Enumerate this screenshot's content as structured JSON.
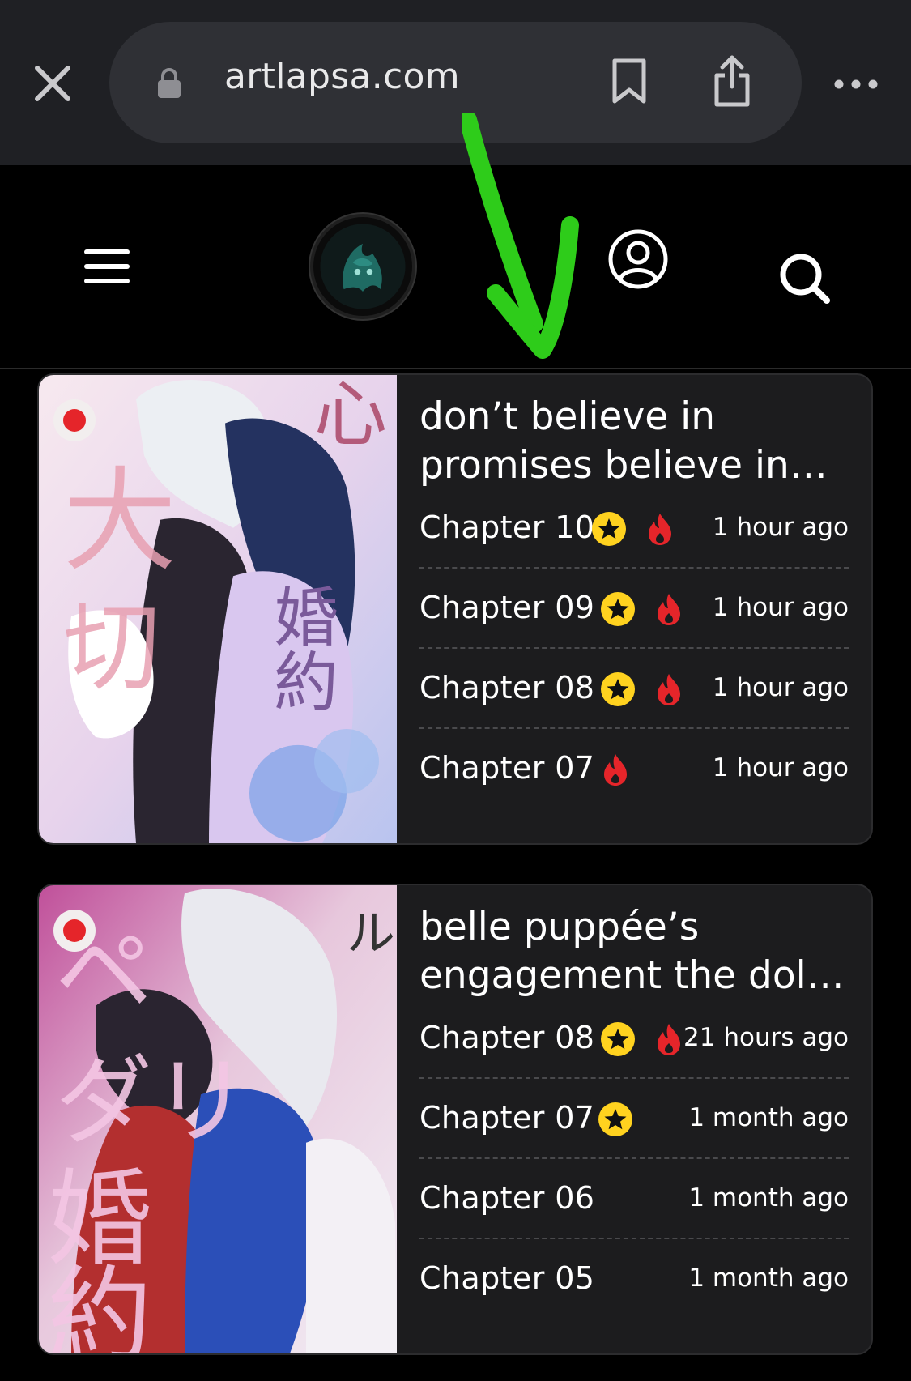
{
  "browser": {
    "url": "artlapsa.com",
    "icons": [
      "close-icon",
      "lock-icon",
      "bookmark-icon",
      "share-icon",
      "more-icon"
    ]
  },
  "header": {
    "icons": [
      "hamburger-icon",
      "site-logo",
      "user-icon",
      "search-icon"
    ]
  },
  "colors": {
    "background": "#000000",
    "card": "#1c1c1e",
    "star_badge": "#ffd21f",
    "fire_icon": "#e5252a",
    "annotation_arrow": "#2ecc1a"
  },
  "series": [
    {
      "title_line1": "don’t believe in",
      "title_line2": "promises believe in…",
      "chapters": [
        {
          "name": "Chapter 10",
          "time": "1 hour ago",
          "star": true,
          "fire": true
        },
        {
          "name": "Chapter 09",
          "time": "1 hour ago",
          "star": true,
          "fire": true
        },
        {
          "name": "Chapter 08",
          "time": "1 hour ago",
          "star": true,
          "fire": true
        },
        {
          "name": "Chapter 07",
          "time": "1 hour ago",
          "star": false,
          "fire": true
        }
      ]
    },
    {
      "title_line1": "belle puppée’s",
      "title_line2": "engagement the dol…",
      "chapters": [
        {
          "name": "Chapter 08",
          "time": "21 hours ago",
          "star": true,
          "fire": true
        },
        {
          "name": "Chapter 07",
          "time": "1 month ago",
          "star": true,
          "fire": false
        },
        {
          "name": "Chapter 06",
          "time": "1 month ago",
          "star": false,
          "fire": false
        },
        {
          "name": "Chapter 05",
          "time": "1 month ago",
          "star": false,
          "fire": false
        }
      ]
    }
  ]
}
